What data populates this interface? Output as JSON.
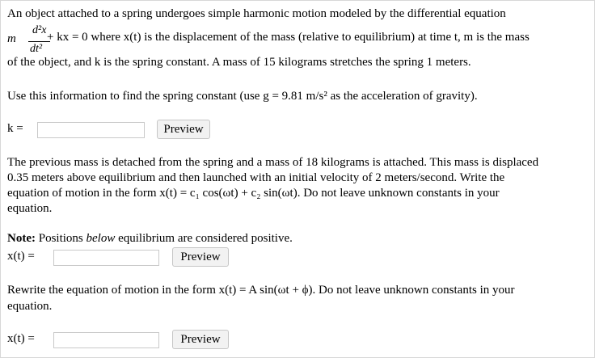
{
  "problem": {
    "line1": "An object attached to a spring undergoes simple harmonic motion modeled by the differential equation",
    "frac_num": "d²x",
    "frac_den": "dt²",
    "frac_m": "m",
    "line2_rest": "+ kx = 0 where x(t) is the displacement of the mass (relative to equilibrium) at time t, m is the mass",
    "line3": "of the object, and k is the spring constant. A mass of 15 kilograms stretches the spring 1 meters.",
    "line4": "Use this information to find the spring constant (use g = 9.81 m/s² as the acceleration of gravity).",
    "k_label": "k =",
    "part2_line1": "The previous mass is detached from the spring and a mass of 18 kilograms is attached. This mass is displaced",
    "part2_line2": "0.35 meters above equilibrium and then launched with an initial velocity of 2 meters/second. Write the",
    "part2_line3": "equation of motion in the form x(t) = c₁ cos(ωt) + c₂ sin(ωt). Do not leave unknown constants in your",
    "part2_line4": "equation.",
    "note_bold": "Note:",
    "note_rest_a": " Positions ",
    "note_italic": "below",
    "note_rest_b": " equilibrium are considered positive.",
    "x1_label": "x(t) =",
    "part3_line1": "Rewrite the equation of motion in the form x(t) = A sin(ωt + ϕ). Do not leave unknown constants in your",
    "part3_line2": "equation.",
    "x2_label": "x(t) ="
  },
  "inputs": {
    "k_value": "",
    "x1_value": "",
    "x2_value": ""
  },
  "buttons": {
    "preview_label": "Preview"
  }
}
